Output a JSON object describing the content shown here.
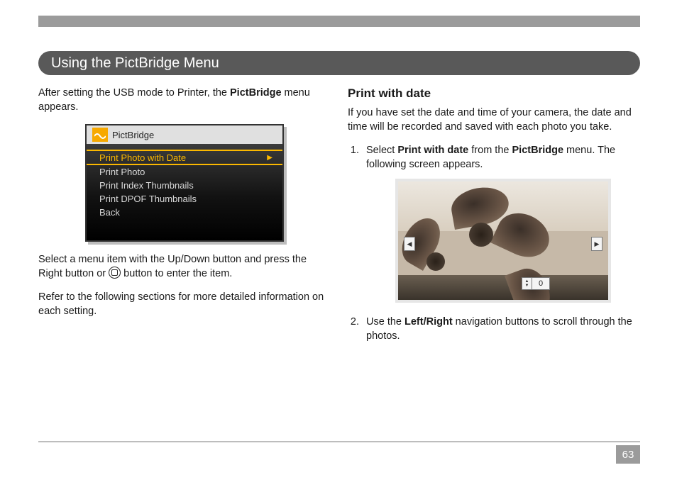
{
  "section_title": "Using the PictBridge Menu",
  "page_number": "63",
  "left": {
    "intro_pre": "After setting the USB mode to Printer, the ",
    "intro_bold": "PictBridge",
    "intro_post": " menu appears.",
    "pb_label": "PictBridge",
    "menu_items": [
      "Print Photo with Date",
      "Print Photo",
      "Print Index Thumbnails",
      "Print DPOF Thumbnails",
      "Back"
    ],
    "para2_pre": "Select a menu item with the Up/Down button and press the Right button or ",
    "para2_post": " button to enter the item.",
    "para3": "Refer to the following sections for more detailed information on each setting."
  },
  "right": {
    "heading": "Print with date",
    "intro": "If you have set the date and time of your camera, the date and time will be recorded and saved with each photo you take.",
    "step1_pre": "Select ",
    "step1_b1": "Print with date",
    "step1_mid": " from the ",
    "step1_b2": "PictBridge",
    "step1_post": " menu.  The following screen appears.",
    "counter_value": "0",
    "step2_pre": "Use the ",
    "step2_bold": "Left/Right",
    "step2_post": " navigation buttons to scroll through the photos."
  }
}
